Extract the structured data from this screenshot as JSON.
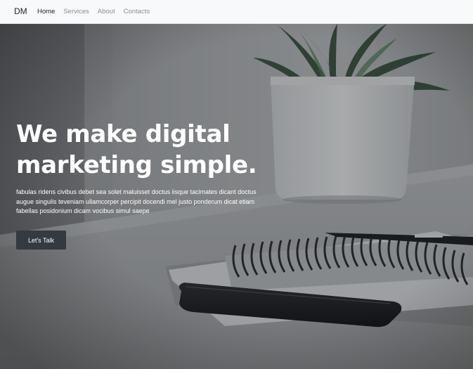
{
  "navbar": {
    "brand": "DM",
    "links": [
      {
        "label": "Home",
        "active": true
      },
      {
        "label": "Services",
        "active": false
      },
      {
        "label": "About",
        "active": false
      },
      {
        "label": "Contacts",
        "active": false
      }
    ]
  },
  "hero": {
    "headline_line1": "We make digital",
    "headline_line2": "marketing simple.",
    "subtext": "fabulas ridens civibus debet sea solet maluisset doctus iisque tacimates dicant doctus augue singulis teveniam ullamcorper percipit docendi mel justo ponderum dicat etiam fabellas posidonium dicam vocibus simul saepe",
    "cta_label": "Let's Talk",
    "background_image": "desk-notebook-phone-plant-photo"
  },
  "colors": {
    "navbar_bg": "#f8f9fa",
    "nav_active": "#212529",
    "nav_inactive": "#8a8f94",
    "cta_bg": "#343a40",
    "hero_text": "#ffffff"
  }
}
